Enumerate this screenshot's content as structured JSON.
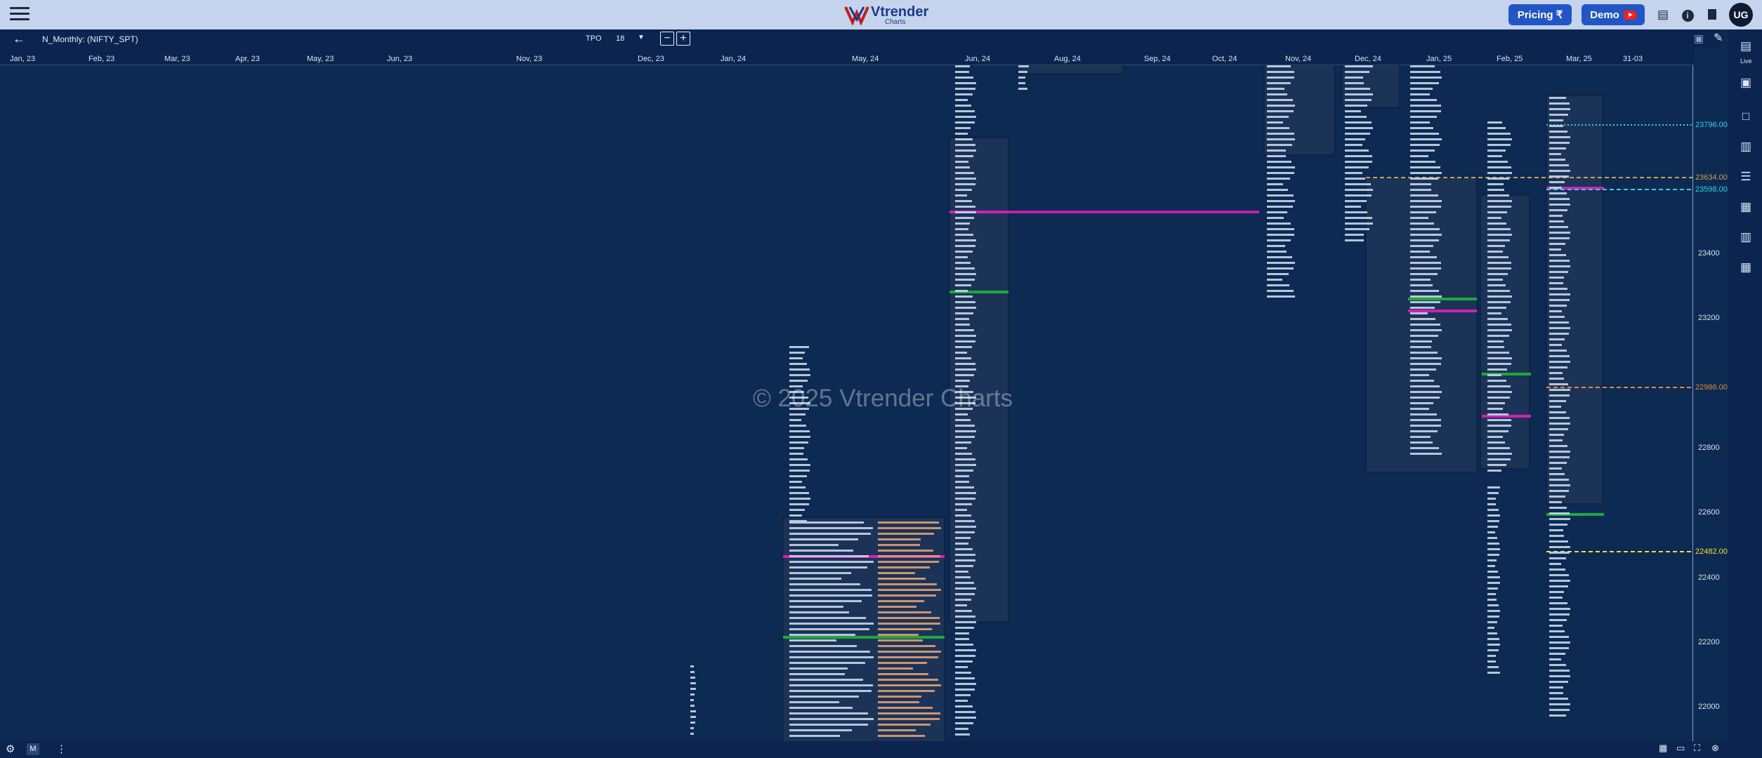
{
  "header": {
    "logo_text": "Vtrender",
    "logo_sub": "Charts",
    "pricing_label": "Pricing ₹",
    "demo_label": "Demo",
    "avatar_initials": "UG"
  },
  "toolbar": {
    "symbol": "N_Monthly: (NIFTY_SPT)",
    "chart_type_label": "TPO",
    "tick_size": "18"
  },
  "date_axis": [
    "Jan, 23",
    "Feb, 23",
    "Mar, 23",
    "Apr, 23",
    "May, 23",
    "Jun, 23",
    "Nov, 23",
    "Dec, 23",
    "Jan, 24",
    "May, 24",
    "Jun, 24",
    "Aug, 24",
    "Sep, 24",
    "Oct, 24",
    "Nov, 24",
    "Dec, 24",
    "Jan, 25",
    "Feb, 25",
    "Mar, 25",
    "31-03"
  ],
  "price_axis": [
    "23400",
    "23200",
    "22800",
    "22600",
    "22400",
    "22200",
    "22000"
  ],
  "levels": [
    {
      "label": "23796.00",
      "color": "#2fd3e6",
      "style": "dotted"
    },
    {
      "label": "23634.00",
      "color": "#c9a44b",
      "style": "dashed"
    },
    {
      "label": "23598.00",
      "color": "#2fd3e6",
      "style": "dashed"
    },
    {
      "label": "22986.00",
      "color": "#e68a2e",
      "style": "dashed"
    },
    {
      "label": "22482.00",
      "color": "#f0e03a",
      "style": "dashed"
    }
  ],
  "watermark": "© 2025 Vtrender Charts",
  "right_sidebar": {
    "live_label": "Live"
  },
  "bottom_bar": {
    "mode_label": "M"
  }
}
